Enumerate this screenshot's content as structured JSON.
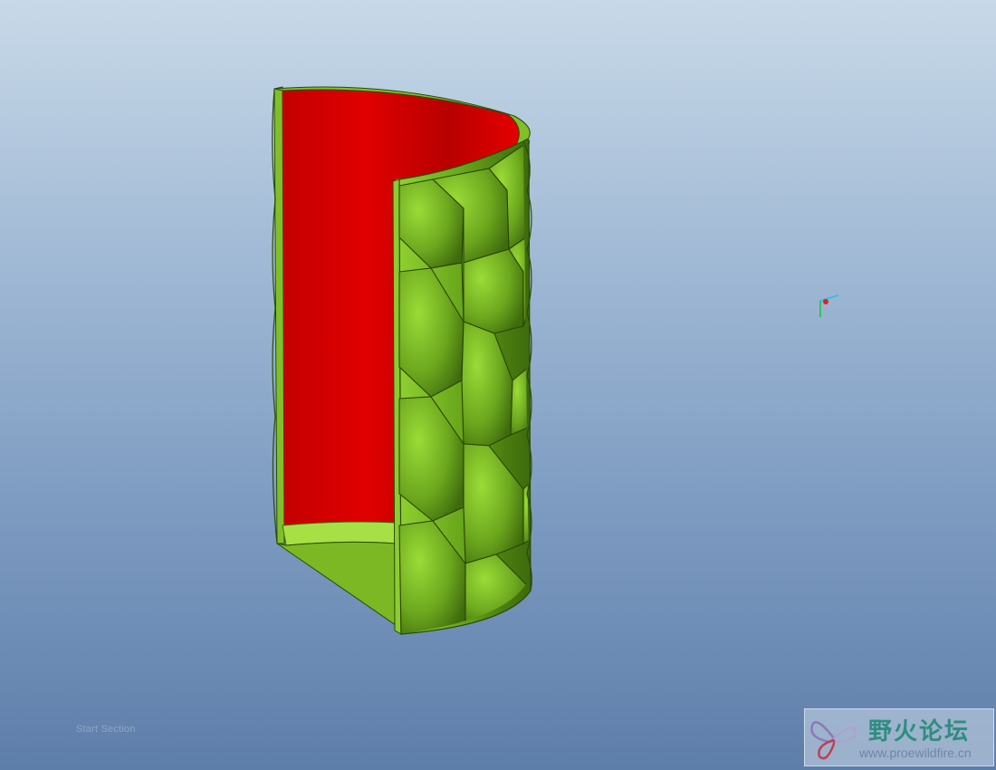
{
  "viewport": {
    "background_top": "#c8d9e8",
    "background_bottom": "#5e7eaa"
  },
  "model": {
    "description": "",
    "outer_color": "#6fae1e",
    "inner_color": "#d40000",
    "section_color": "#8cc63a"
  },
  "csys": {
    "icon": "coordinate-system-icon",
    "x_color": "#22c0e8",
    "y_color": "#20c040",
    "origin_color": "#e02020"
  },
  "status": {
    "text": "Start Section"
  },
  "watermark": {
    "logo_icon": "butterfly-logo-icon",
    "site_name": "野火论坛",
    "url": "www.proewildfire.cn"
  }
}
